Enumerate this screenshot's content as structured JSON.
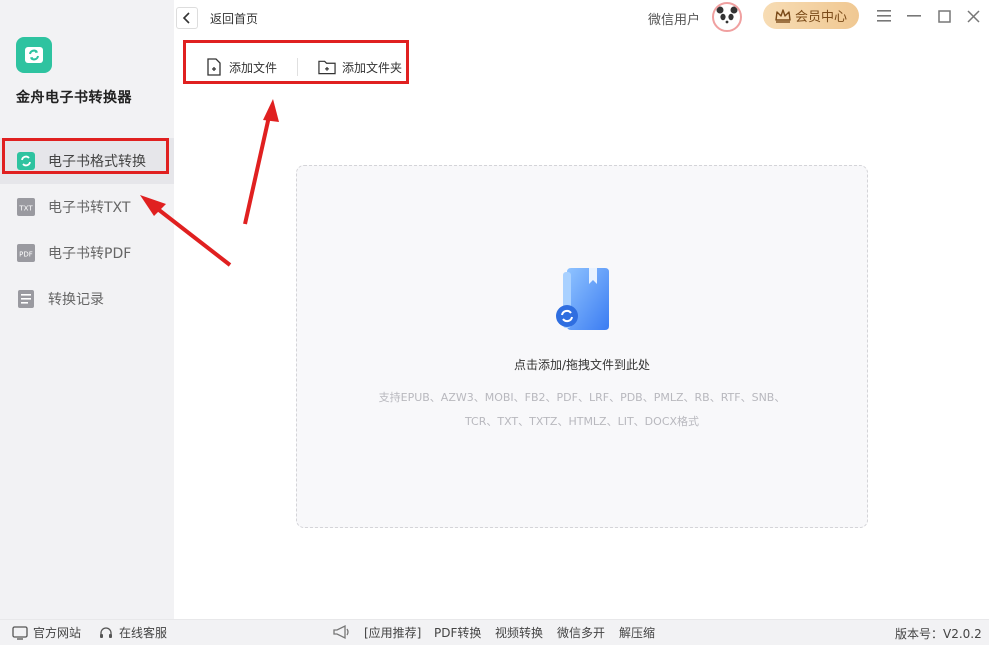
{
  "app": {
    "name": "金舟电子书转换器",
    "accent_color": "#2ec3a0",
    "highlight_color": "#e02020"
  },
  "sidebar": {
    "items": [
      {
        "label": "电子书格式转换",
        "icon": "ebook-convert-icon",
        "active": true
      },
      {
        "label": "电子书转TXT",
        "icon": "txt-icon"
      },
      {
        "label": "电子书转PDF",
        "icon": "pdf-icon"
      },
      {
        "label": "转换记录",
        "icon": "history-icon"
      }
    ]
  },
  "header": {
    "back_label": "返回首页",
    "user_name": "微信用户",
    "vip_label": "会员中心"
  },
  "toolbar": {
    "add_file": "添加文件",
    "add_folder": "添加文件夹"
  },
  "dropzone": {
    "title": "点击添加/拖拽文件到此处",
    "formats_line1": "支持EPUB、AZW3、MOBI、FB2、PDF、LRF、PDB、PMLZ、RB、RTF、SNB、",
    "formats_line2": "TCR、TXT、TXTZ、HTMLZ、LIT、DOCX格式"
  },
  "footer": {
    "official_site": "官方网站",
    "online_service": "在线客服",
    "recommend_label": "[应用推荐]",
    "recommend": [
      "PDF转换",
      "视频转换",
      "微信多开",
      "解压缩"
    ],
    "version": "版本号：V2.0.2"
  }
}
